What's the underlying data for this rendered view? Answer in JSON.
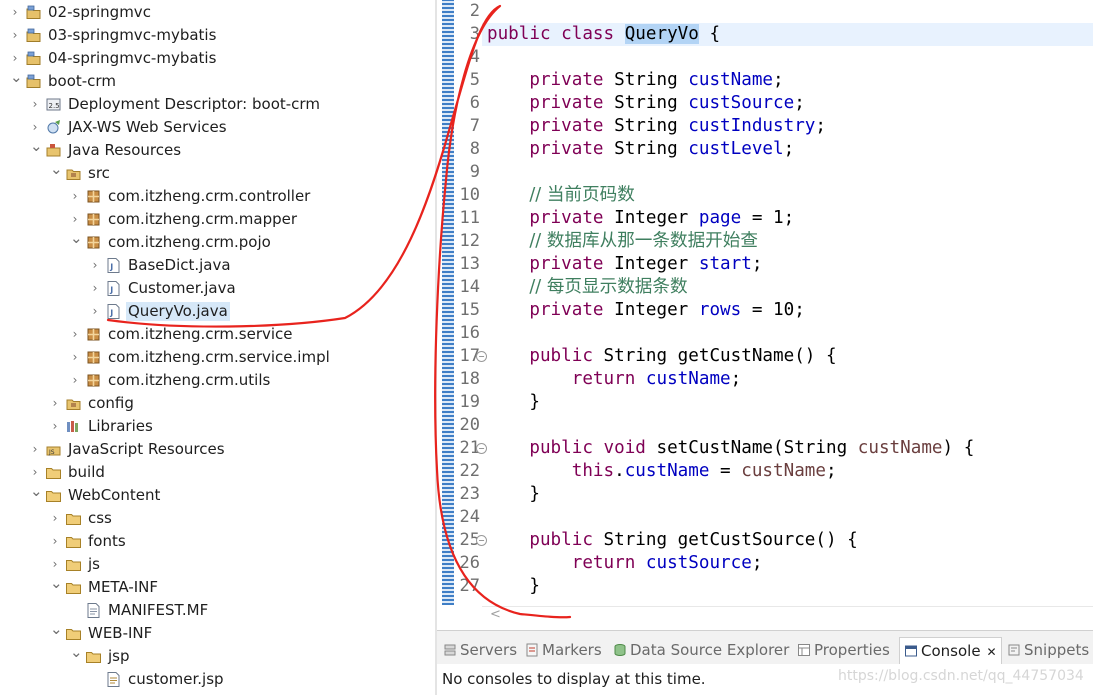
{
  "tree": [
    {
      "label": "02-springmvc",
      "depth": 0,
      "state": "collapsed",
      "icon": "project-icon"
    },
    {
      "label": "03-springmvc-mybatis",
      "depth": 0,
      "state": "collapsed",
      "icon": "project-icon"
    },
    {
      "label": "04-springmvc-mybatis",
      "depth": 0,
      "state": "collapsed",
      "icon": "project-icon"
    },
    {
      "label": "boot-crm",
      "depth": 0,
      "state": "expanded",
      "icon": "project-icon"
    },
    {
      "label": "Deployment Descriptor: boot-crm",
      "depth": 1,
      "state": "collapsed",
      "icon": "descriptor-icon"
    },
    {
      "label": "JAX-WS Web Services",
      "depth": 1,
      "state": "collapsed",
      "icon": "webservice-icon"
    },
    {
      "label": "Java Resources",
      "depth": 1,
      "state": "expanded",
      "icon": "java-resources-icon"
    },
    {
      "label": "src",
      "depth": 2,
      "state": "expanded",
      "icon": "source-folder-icon"
    },
    {
      "label": "com.itzheng.crm.controller",
      "depth": 3,
      "state": "collapsed",
      "icon": "package-icon"
    },
    {
      "label": "com.itzheng.crm.mapper",
      "depth": 3,
      "state": "collapsed",
      "icon": "package-icon"
    },
    {
      "label": "com.itzheng.crm.pojo",
      "depth": 3,
      "state": "expanded",
      "icon": "package-icon"
    },
    {
      "label": "BaseDict.java",
      "depth": 4,
      "state": "collapsed",
      "icon": "java-file-icon"
    },
    {
      "label": "Customer.java",
      "depth": 4,
      "state": "collapsed",
      "icon": "java-file-icon"
    },
    {
      "label": "QueryVo.java",
      "depth": 4,
      "state": "collapsed",
      "icon": "java-file-icon",
      "selected": true
    },
    {
      "label": "com.itzheng.crm.service",
      "depth": 3,
      "state": "collapsed",
      "icon": "package-icon"
    },
    {
      "label": "com.itzheng.crm.service.impl",
      "depth": 3,
      "state": "collapsed",
      "icon": "package-icon"
    },
    {
      "label": "com.itzheng.crm.utils",
      "depth": 3,
      "state": "collapsed",
      "icon": "package-icon"
    },
    {
      "label": "config",
      "depth": 2,
      "state": "collapsed",
      "icon": "source-folder-icon"
    },
    {
      "label": "Libraries",
      "depth": 2,
      "state": "collapsed",
      "icon": "library-icon"
    },
    {
      "label": "JavaScript Resources",
      "depth": 1,
      "state": "collapsed",
      "icon": "js-resources-icon"
    },
    {
      "label": "build",
      "depth": 1,
      "state": "collapsed",
      "icon": "folder-icon"
    },
    {
      "label": "WebContent",
      "depth": 1,
      "state": "expanded",
      "icon": "folder-icon"
    },
    {
      "label": "css",
      "depth": 2,
      "state": "collapsed",
      "icon": "folder-icon"
    },
    {
      "label": "fonts",
      "depth": 2,
      "state": "collapsed",
      "icon": "folder-icon"
    },
    {
      "label": "js",
      "depth": 2,
      "state": "collapsed",
      "icon": "folder-icon"
    },
    {
      "label": "META-INF",
      "depth": 2,
      "state": "expanded",
      "icon": "folder-icon"
    },
    {
      "label": "MANIFEST.MF",
      "depth": 3,
      "state": "leaf",
      "icon": "text-file-icon"
    },
    {
      "label": "WEB-INF",
      "depth": 2,
      "state": "expanded",
      "icon": "folder-icon"
    },
    {
      "label": "jsp",
      "depth": 3,
      "state": "expanded",
      "icon": "folder-icon"
    },
    {
      "label": "customer.jsp",
      "depth": 4,
      "state": "leaf",
      "icon": "jsp-file-icon"
    }
  ],
  "editor": {
    "lines": [
      {
        "n": "2",
        "fold": false,
        "tokens": []
      },
      {
        "n": "3",
        "fold": false,
        "current": true,
        "tokens": [
          [
            "kw",
            "public"
          ],
          [
            "",
            " "
          ],
          [
            "kw",
            "class"
          ],
          [
            "",
            " "
          ],
          [
            "hl",
            "QueryVo"
          ],
          [
            "",
            " {"
          ]
        ]
      },
      {
        "n": "4",
        "fold": false,
        "tokens": []
      },
      {
        "n": "5",
        "fold": false,
        "tokens": [
          [
            "",
            "    "
          ],
          [
            "kw",
            "private"
          ],
          [
            "",
            " String "
          ],
          [
            "fld",
            "custName"
          ],
          [
            "",
            ";"
          ]
        ]
      },
      {
        "n": "6",
        "fold": false,
        "tokens": [
          [
            "",
            "    "
          ],
          [
            "kw",
            "private"
          ],
          [
            "",
            " String "
          ],
          [
            "fld",
            "custSource"
          ],
          [
            "",
            ";"
          ]
        ]
      },
      {
        "n": "7",
        "fold": false,
        "tokens": [
          [
            "",
            "    "
          ],
          [
            "kw",
            "private"
          ],
          [
            "",
            " String "
          ],
          [
            "fld",
            "custIndustry"
          ],
          [
            "",
            ";"
          ]
        ]
      },
      {
        "n": "8",
        "fold": false,
        "tokens": [
          [
            "",
            "    "
          ],
          [
            "kw",
            "private"
          ],
          [
            "",
            " String "
          ],
          [
            "fld",
            "custLevel"
          ],
          [
            "",
            ";"
          ]
        ]
      },
      {
        "n": "9",
        "fold": false,
        "tokens": []
      },
      {
        "n": "10",
        "fold": false,
        "tokens": [
          [
            "",
            "    "
          ],
          [
            "cmt",
            "// 当前页码数"
          ]
        ]
      },
      {
        "n": "11",
        "fold": false,
        "tokens": [
          [
            "",
            "    "
          ],
          [
            "kw",
            "private"
          ],
          [
            "",
            " Integer "
          ],
          [
            "fld",
            "page"
          ],
          [
            "",
            " = 1;"
          ]
        ]
      },
      {
        "n": "12",
        "fold": false,
        "tokens": [
          [
            "",
            "    "
          ],
          [
            "cmt",
            "// 数据库从那一条数据开始查"
          ]
        ]
      },
      {
        "n": "13",
        "fold": false,
        "tokens": [
          [
            "",
            "    "
          ],
          [
            "kw",
            "private"
          ],
          [
            "",
            " Integer "
          ],
          [
            "fld",
            "start"
          ],
          [
            "",
            ";"
          ]
        ]
      },
      {
        "n": "14",
        "fold": false,
        "tokens": [
          [
            "",
            "    "
          ],
          [
            "cmt",
            "// 每页显示数据条数"
          ]
        ]
      },
      {
        "n": "15",
        "fold": false,
        "tokens": [
          [
            "",
            "    "
          ],
          [
            "kw",
            "private"
          ],
          [
            "",
            " Integer "
          ],
          [
            "fld",
            "rows"
          ],
          [
            "",
            " = 10;"
          ]
        ]
      },
      {
        "n": "16",
        "fold": false,
        "tokens": []
      },
      {
        "n": "17",
        "fold": true,
        "tokens": [
          [
            "",
            "    "
          ],
          [
            "kw",
            "public"
          ],
          [
            "",
            " String getCustName() {"
          ]
        ]
      },
      {
        "n": "18",
        "fold": false,
        "tokens": [
          [
            "",
            "        "
          ],
          [
            "kw",
            "return"
          ],
          [
            "",
            " "
          ],
          [
            "fld",
            "custName"
          ],
          [
            "",
            ";"
          ]
        ]
      },
      {
        "n": "19",
        "fold": false,
        "tokens": [
          [
            "",
            "    }"
          ]
        ]
      },
      {
        "n": "20",
        "fold": false,
        "tokens": []
      },
      {
        "n": "21",
        "fold": true,
        "tokens": [
          [
            "",
            "    "
          ],
          [
            "kw",
            "public"
          ],
          [
            "",
            " "
          ],
          [
            "kw",
            "void"
          ],
          [
            "",
            " setCustName(String "
          ],
          [
            "prm",
            "custName"
          ],
          [
            "",
            ") {"
          ]
        ]
      },
      {
        "n": "22",
        "fold": false,
        "tokens": [
          [
            "",
            "        "
          ],
          [
            "kw",
            "this"
          ],
          [
            "",
            "."
          ],
          [
            "fld",
            "custName"
          ],
          [
            "",
            " = "
          ],
          [
            "prm",
            "custName"
          ],
          [
            "",
            ";"
          ]
        ]
      },
      {
        "n": "23",
        "fold": false,
        "tokens": [
          [
            "",
            "    }"
          ]
        ]
      },
      {
        "n": "24",
        "fold": false,
        "tokens": []
      },
      {
        "n": "25",
        "fold": true,
        "tokens": [
          [
            "",
            "    "
          ],
          [
            "kw",
            "public"
          ],
          [
            "",
            " String getCustSource() {"
          ]
        ]
      },
      {
        "n": "26",
        "fold": false,
        "tokens": [
          [
            "",
            "        "
          ],
          [
            "kw",
            "return"
          ],
          [
            "",
            " "
          ],
          [
            "fld",
            "custSource"
          ],
          [
            "",
            ";"
          ]
        ]
      },
      {
        "n": "27",
        "fold": false,
        "tokens": [
          [
            "",
            "    }"
          ]
        ]
      }
    ]
  },
  "bottom_tabs": [
    {
      "label": "Servers",
      "icon": "servers-icon"
    },
    {
      "label": "Markers",
      "icon": "markers-icon"
    },
    {
      "label": "Data Source Explorer",
      "icon": "data-source-icon"
    },
    {
      "label": "Properties",
      "icon": "properties-icon"
    },
    {
      "label": "Console",
      "icon": "console-icon",
      "active": true,
      "close": "✕"
    },
    {
      "label": "Snippets",
      "icon": "snippets-icon"
    }
  ],
  "console": {
    "message": "No consoles to display at this time."
  },
  "watermark": "https://blog.csdn.net/qq_44757034",
  "colors": {
    "keyword": "#7f0055",
    "field": "#0000c0",
    "param": "#6a3e3e",
    "comment": "#3f7f5f",
    "annotation": "#e8231d"
  }
}
